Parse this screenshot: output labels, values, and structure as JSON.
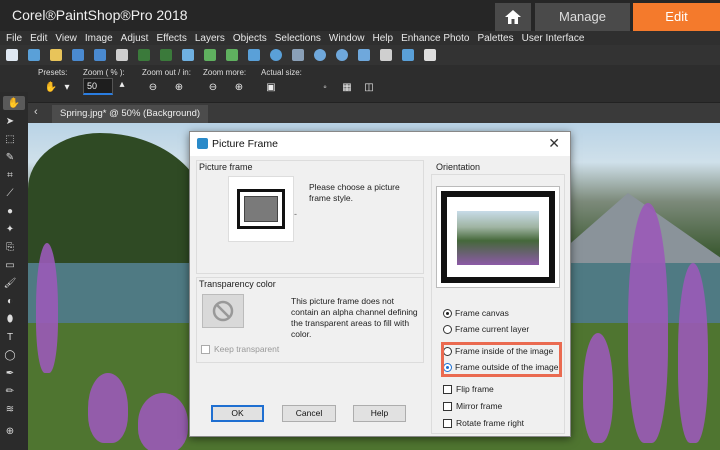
{
  "app": {
    "title": "Corel®PaintShop®Pro 2018",
    "tabs": {
      "manage": "Manage",
      "edit": "Edit"
    },
    "accent": "#f47a2c"
  },
  "menu": [
    "File",
    "Edit",
    "View",
    "Image",
    "Adjust",
    "Effects",
    "Layers",
    "Objects",
    "Selections",
    "Window",
    "Help",
    "Enhance Photo",
    "Palettes",
    "User Interface"
  ],
  "options": {
    "presets": "Presets:",
    "zoom_label": "Zoom ( % ):",
    "zoom_value": "50",
    "zoom_out_in": "Zoom out / in:",
    "zoom_more": "Zoom more:",
    "actual_size": "Actual size:"
  },
  "document": {
    "tab": "Spring.jpg* @  50% (Background)"
  },
  "dialog": {
    "title": "Picture Frame",
    "picture_frame": {
      "label": "Picture frame",
      "hint": "Please choose a picture frame style.",
      "dash": "-"
    },
    "transparency": {
      "label": "Transparency color",
      "message": "This picture frame does not contain an alpha channel defining the transparent areas to fill with color.",
      "keep_transparent": "Keep transparent"
    },
    "orientation": {
      "label": "Orientation",
      "frame_canvas": "Frame canvas",
      "frame_current_layer": "Frame current layer",
      "frame_inside": "Frame inside of the image",
      "frame_outside": "Frame outside of the image",
      "flip_frame": "Flip frame",
      "mirror_frame": "Mirror frame",
      "rotate_frame_right": "Rotate frame right"
    },
    "buttons": {
      "ok": "OK",
      "cancel": "Cancel",
      "help": "Help"
    },
    "highlight_color": "#ea6a50"
  }
}
